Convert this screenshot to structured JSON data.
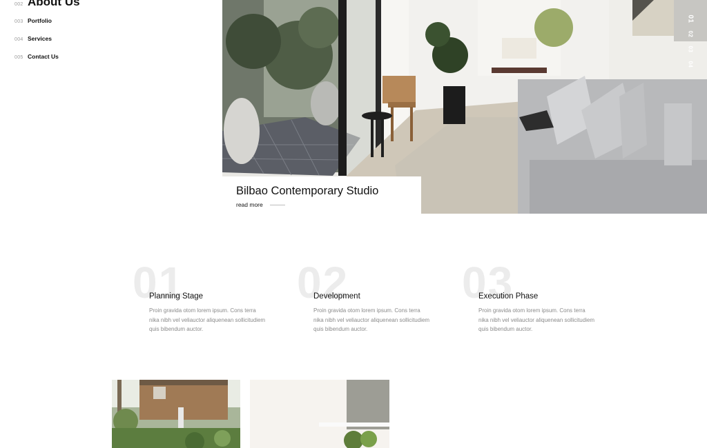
{
  "nav": {
    "items": [
      {
        "num": "002",
        "label": "About Us"
      },
      {
        "num": "003",
        "label": "Portfolio"
      },
      {
        "num": "004",
        "label": "Services"
      },
      {
        "num": "005",
        "label": "Contact Us"
      }
    ]
  },
  "hero": {
    "slides": [
      "01",
      "02",
      "03",
      "04"
    ],
    "caption_title": "Bilbao Contemporary Studio",
    "caption_link": "read more"
  },
  "steps": [
    {
      "num": "01",
      "title": "Planning Stage",
      "text": "Proin gravida otom lorem ipsum. Cons terra nika nibh vel veliauctor aliquenean sollicitudiem quis bibendum auctor."
    },
    {
      "num": "02",
      "title": "Development",
      "text": "Proin gravida otom lorem ipsum. Cons terra nika nibh vel veliauctor aliquenean sollicitudiem quis bibendum auctor."
    },
    {
      "num": "03",
      "title": "Execution Phase",
      "text": "Proin gravida otom lorem ipsum. Cons terra nika nibh vel veliauctor aliquenean sollicitudiem quis bibendum auctor."
    }
  ]
}
